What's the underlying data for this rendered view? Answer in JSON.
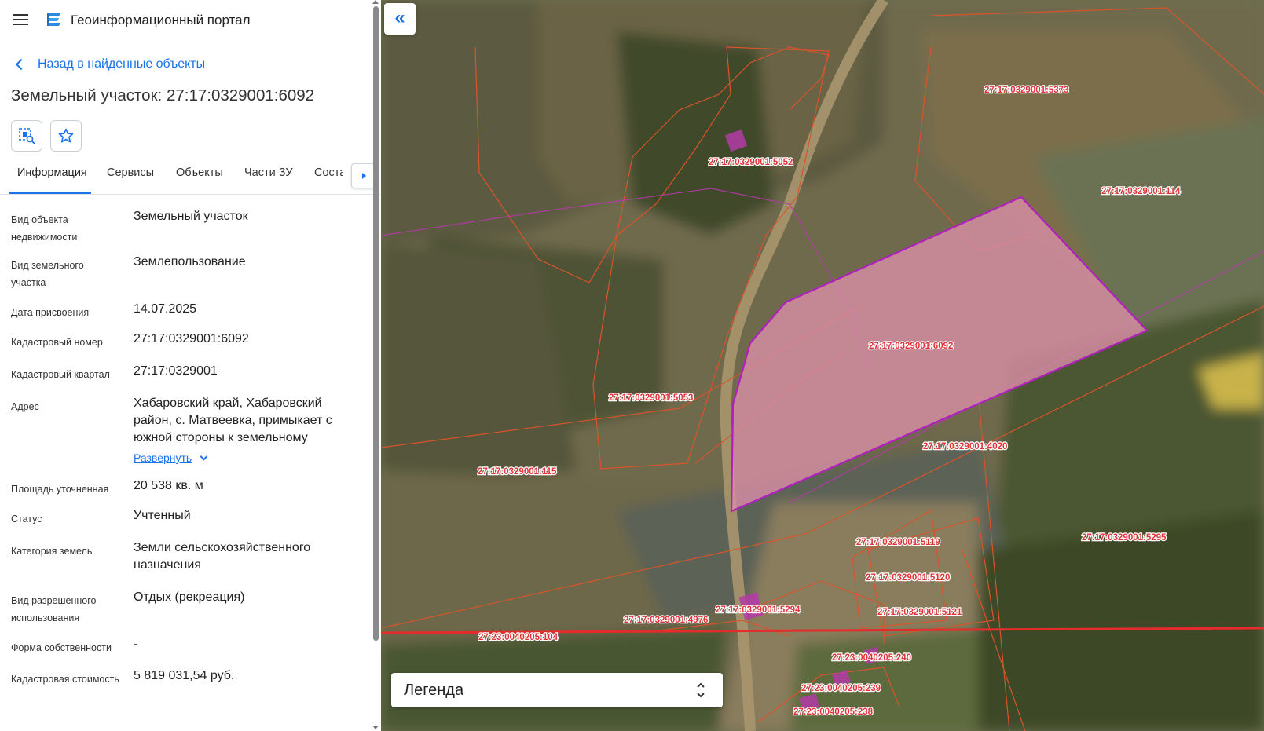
{
  "header": {
    "app_title": "Геоинформационный портал"
  },
  "nav": {
    "back_label": "Назад в найденные объекты"
  },
  "object": {
    "title": "Земельный участок: 27:17:0329001:6092"
  },
  "tabs": [
    {
      "label": "Информация",
      "active": true
    },
    {
      "label": "Сервисы"
    },
    {
      "label": "Объекты"
    },
    {
      "label": "Части ЗУ"
    },
    {
      "label": "Соста"
    }
  ],
  "properties": [
    {
      "label": "Вид объекта недвижимости",
      "value": "Земельный участок"
    },
    {
      "label": "Вид земельного участка",
      "value": "Землепользование"
    },
    {
      "label": "Дата присвоения",
      "value": "14.07.2025"
    },
    {
      "label": "Кадастровый номер",
      "value": "27:17:0329001:6092"
    },
    {
      "label": "Кадастровый квартал",
      "value": "27:17:0329001"
    },
    {
      "label": "Адрес",
      "value": "Хабаровский край, Хабаровский район, с. Матвеевка, примыкает с южной стороны к земельному"
    },
    {
      "label": "Площадь уточненная",
      "value": "20 538 кв. м"
    },
    {
      "label": "Статус",
      "value": "Учтенный"
    },
    {
      "label": "Категория земель",
      "value": "Земли сельскохозяйственного назначения"
    },
    {
      "label": "Вид разрешенного использования",
      "value": "Отдых (рекреация)"
    },
    {
      "label": "Форма собственности",
      "value": "-"
    },
    {
      "label": "Кадастровая стоимость",
      "value": "5 819 031,54 руб."
    }
  ],
  "address_expand_label": "Развернуть",
  "map": {
    "legend_label": "Легенда",
    "parcel_labels": [
      "27:17:0329001:5373",
      "27:17:0329001:5052",
      "27:17:0329001:114",
      "27:17:0329001:6092",
      "27:17:0329001:5053",
      "27:17:0329001:4020",
      "27:17:0329001:115",
      "27:17:0329001:5295",
      "27:17:0329001:5119",
      "27:17:0329001:5120",
      "27:17:0329001:5121",
      "27:17:0329001:5294",
      "27:17:0329001:4976",
      "27:23:0040205:104",
      "27:23:0040205:240",
      "27:23:0040205:239",
      "27:23:0040205:238"
    ],
    "colors": {
      "selected_fill": "#d98fa6",
      "selected_stroke": "#b01fbf",
      "parcel_stroke": "#d9542b",
      "quarter_line": "#e52b2b",
      "label_text": "#e0343a",
      "accent": "#1a73e8"
    }
  }
}
